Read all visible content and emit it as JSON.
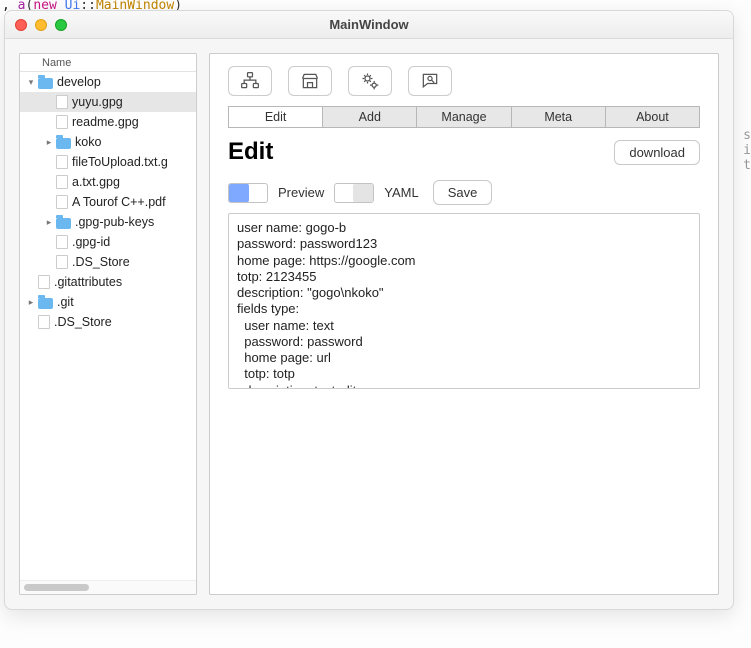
{
  "window": {
    "title": "MainWindow"
  },
  "sidebar": {
    "column_header": "Name",
    "items": [
      {
        "label": "develop",
        "type": "folder",
        "depth": 0,
        "twisty": "open"
      },
      {
        "label": "yuyu.gpg",
        "type": "file",
        "depth": 1,
        "selected": true
      },
      {
        "label": "readme.gpg",
        "type": "file",
        "depth": 1
      },
      {
        "label": "koko",
        "type": "folder",
        "depth": 1,
        "twisty": "closed"
      },
      {
        "label": "fileToUpload.txt.g",
        "type": "file",
        "depth": 1
      },
      {
        "label": "a.txt.gpg",
        "type": "file",
        "depth": 1
      },
      {
        "label": "A Tourof C++.pdf",
        "type": "file",
        "depth": 1
      },
      {
        "label": ".gpg-pub-keys",
        "type": "folder",
        "depth": 1,
        "twisty": "closed"
      },
      {
        "label": ".gpg-id",
        "type": "file",
        "depth": 1
      },
      {
        "label": ".DS_Store",
        "type": "file",
        "depth": 1
      },
      {
        "label": ".gitattributes",
        "type": "file",
        "depth": 0
      },
      {
        "label": ".git",
        "type": "folder",
        "depth": 0,
        "twisty": "closed"
      },
      {
        "label": ".DS_Store",
        "type": "file",
        "depth": 0
      }
    ]
  },
  "toolbar": {
    "icons": [
      "org-chart-icon",
      "store-icon",
      "gears-icon",
      "message-search-icon"
    ]
  },
  "tabs": [
    "Edit",
    "Add",
    "Manage",
    "Meta",
    "About"
  ],
  "active_tab": "Edit",
  "heading": "Edit",
  "download_button": "download",
  "toggles": {
    "preview": {
      "label": "Preview",
      "on": true
    },
    "yaml": {
      "label": "YAML",
      "on": false
    },
    "save_button": "Save"
  },
  "editor_text": "user name: gogo-b\npassword: password123\nhome page: https://google.com\ntotp: 2123455\ndescription: \"gogo\\nkoko\"\nfields type:\n  user name: text\n  password: password\n  home page: url\n  totp: totp\n  description: textedit"
}
